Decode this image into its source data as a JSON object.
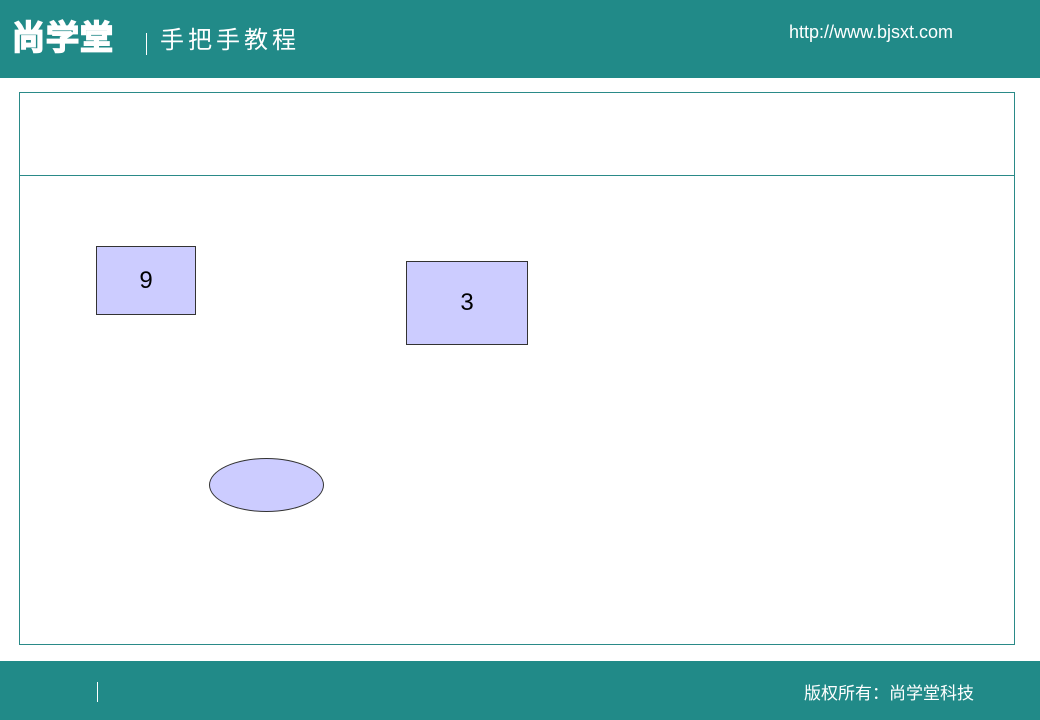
{
  "header": {
    "logo_text": "尚学堂",
    "subtitle": "手把手教程",
    "url": "http://www.bjsxt.com"
  },
  "diagram": {
    "boxes": [
      {
        "label": "9"
      },
      {
        "label": "3"
      }
    ]
  },
  "footer": {
    "copyright": "版权所有：尚学堂科技"
  },
  "colors": {
    "brand_teal": "#218a88",
    "node_fill": "#ccccff",
    "node_border": "#333333"
  }
}
